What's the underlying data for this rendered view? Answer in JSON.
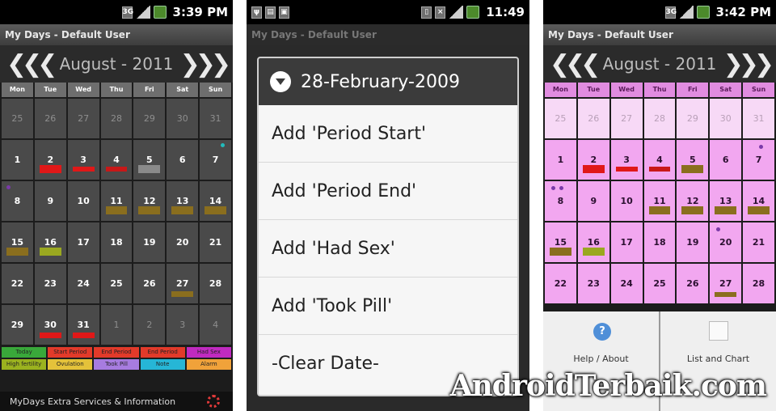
{
  "app_title": "My Days - Default User",
  "colors": {
    "period": "#e01818",
    "period_end": "#c81818",
    "sex": "#8a6e1e",
    "pill": "#9aa820",
    "dot_purple": "#7a3aa8",
    "legend": [
      "#39a83a",
      "#e23a2a",
      "#e23a2a",
      "#e23a2a",
      "#c02ac0",
      "#9bb21f",
      "#e4c23a",
      "#a77ce0",
      "#26b6d6",
      "#f0a23a"
    ]
  },
  "screens": [
    {
      "status_time": "3:39 PM",
      "month": "August - 2011",
      "weekdays": [
        "Mon",
        "Tue",
        "Wed",
        "Thu",
        "Fri",
        "Sat",
        "Sun"
      ],
      "days": [
        "25",
        "26",
        "27",
        "28",
        "29",
        "30",
        "31",
        "1",
        "2",
        "3",
        "4",
        "5",
        "6",
        "7",
        "8",
        "9",
        "10",
        "11",
        "12",
        "13",
        "14",
        "15",
        "16",
        "17",
        "18",
        "19",
        "20",
        "21",
        "22",
        "23",
        "24",
        "25",
        "26",
        "27",
        "28",
        "29",
        "30",
        "31",
        "1",
        "2",
        "3",
        "4"
      ],
      "legend": [
        "Today",
        "Start Period",
        "End Period",
        "End Period",
        "Had Sex",
        "High fertility",
        "Ovulation",
        "Took Pill",
        "Note",
        "Alarm"
      ],
      "footer": "MyDays Extra Services & Information"
    },
    {
      "status_time": "11:49",
      "dialog_title": "28-February-2009",
      "menu": [
        "Add 'Period Start'",
        "Add 'Period End'",
        "Add 'Had Sex'",
        "Add 'Took Pill'",
        "-Clear Date-"
      ]
    },
    {
      "status_time": "3:42 PM",
      "month": "August - 2011",
      "weekdays": [
        "Mon",
        "Tue",
        "Wed",
        "Thu",
        "Fri",
        "Sat",
        "Sun"
      ],
      "days": [
        "25",
        "26",
        "27",
        "28",
        "29",
        "30",
        "31",
        "1",
        "2",
        "3",
        "4",
        "5",
        "6",
        "7",
        "8",
        "9",
        "10",
        "11",
        "12",
        "13",
        "14",
        "15",
        "16",
        "17",
        "18",
        "19",
        "20",
        "21",
        "22",
        "23",
        "24",
        "25",
        "26",
        "27",
        "28"
      ],
      "bottom_menu": [
        "Help / About",
        "List and Chart"
      ]
    }
  ],
  "watermark": "AndroidTerbaik.com"
}
